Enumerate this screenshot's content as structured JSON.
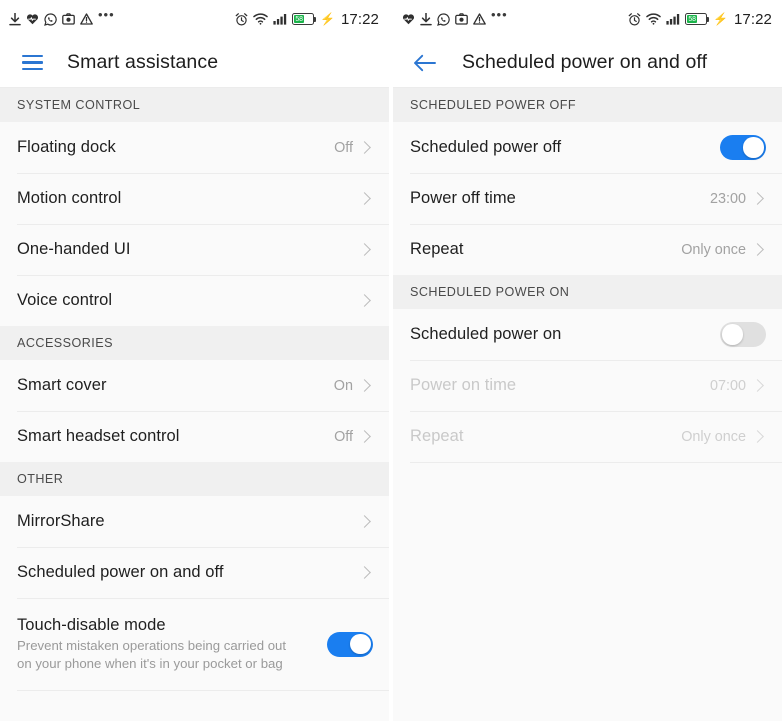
{
  "status_bar": {
    "icons_left": [
      "download-icon",
      "heart-health-icon",
      "whatsapp-icon",
      "camera-icon",
      "warning-triangle-icon",
      "more-dots-icon"
    ],
    "icons_right": [
      "alarm-clock-icon",
      "wifi-icon",
      "signal-bars-icon",
      "battery-icon",
      "charging-bolt-icon"
    ],
    "battery_percent": "58",
    "time": "17:22"
  },
  "left_screen": {
    "menu_icon": "hamburger-menu-icon",
    "title": "Smart assistance",
    "sections": [
      {
        "header": "SYSTEM CONTROL",
        "rows": [
          {
            "title": "Floating dock",
            "value": "Off",
            "control": "chevron"
          },
          {
            "title": "Motion control",
            "value": "",
            "control": "chevron"
          },
          {
            "title": "One-handed UI",
            "value": "",
            "control": "chevron"
          },
          {
            "title": "Voice control",
            "value": "",
            "control": "chevron"
          }
        ]
      },
      {
        "header": "ACCESSORIES",
        "rows": [
          {
            "title": "Smart cover",
            "value": "On",
            "control": "chevron"
          },
          {
            "title": "Smart headset control",
            "value": "Off",
            "control": "chevron"
          }
        ]
      },
      {
        "header": "OTHER",
        "rows": [
          {
            "title": "MirrorShare",
            "value": "",
            "control": "chevron"
          },
          {
            "title": "Scheduled power on and off",
            "value": "",
            "control": "chevron"
          }
        ]
      }
    ],
    "touch_disable": {
      "title": "Touch-disable mode",
      "subtitle": "Prevent mistaken operations being carried out on your phone when it's in your pocket or bag",
      "toggle_on": true
    }
  },
  "right_screen": {
    "back_icon": "back-arrow-icon",
    "title": "Scheduled power on and off",
    "sections": [
      {
        "header": "SCHEDULED POWER OFF",
        "rows": [
          {
            "title": "Scheduled power off",
            "value": "",
            "control": "switch-on",
            "disabled": false
          },
          {
            "title": "Power off time",
            "value": "23:00",
            "control": "chevron",
            "disabled": false
          },
          {
            "title": "Repeat",
            "value": "Only once",
            "control": "chevron",
            "disabled": false
          }
        ]
      },
      {
        "header": "SCHEDULED POWER ON",
        "rows": [
          {
            "title": "Scheduled power on",
            "value": "",
            "control": "switch-off",
            "disabled": false
          },
          {
            "title": "Power on time",
            "value": "07:00",
            "control": "chevron",
            "disabled": true
          },
          {
            "title": "Repeat",
            "value": "Only once",
            "control": "chevron",
            "disabled": true
          }
        ]
      }
    ]
  },
  "colors": {
    "accent_blue": "#1a7ef0",
    "appbar_icon_blue": "#2b76d2",
    "section_bg": "#f0f0f0",
    "row_bg": "#fafafa",
    "battery_green": "#1ab44a"
  }
}
